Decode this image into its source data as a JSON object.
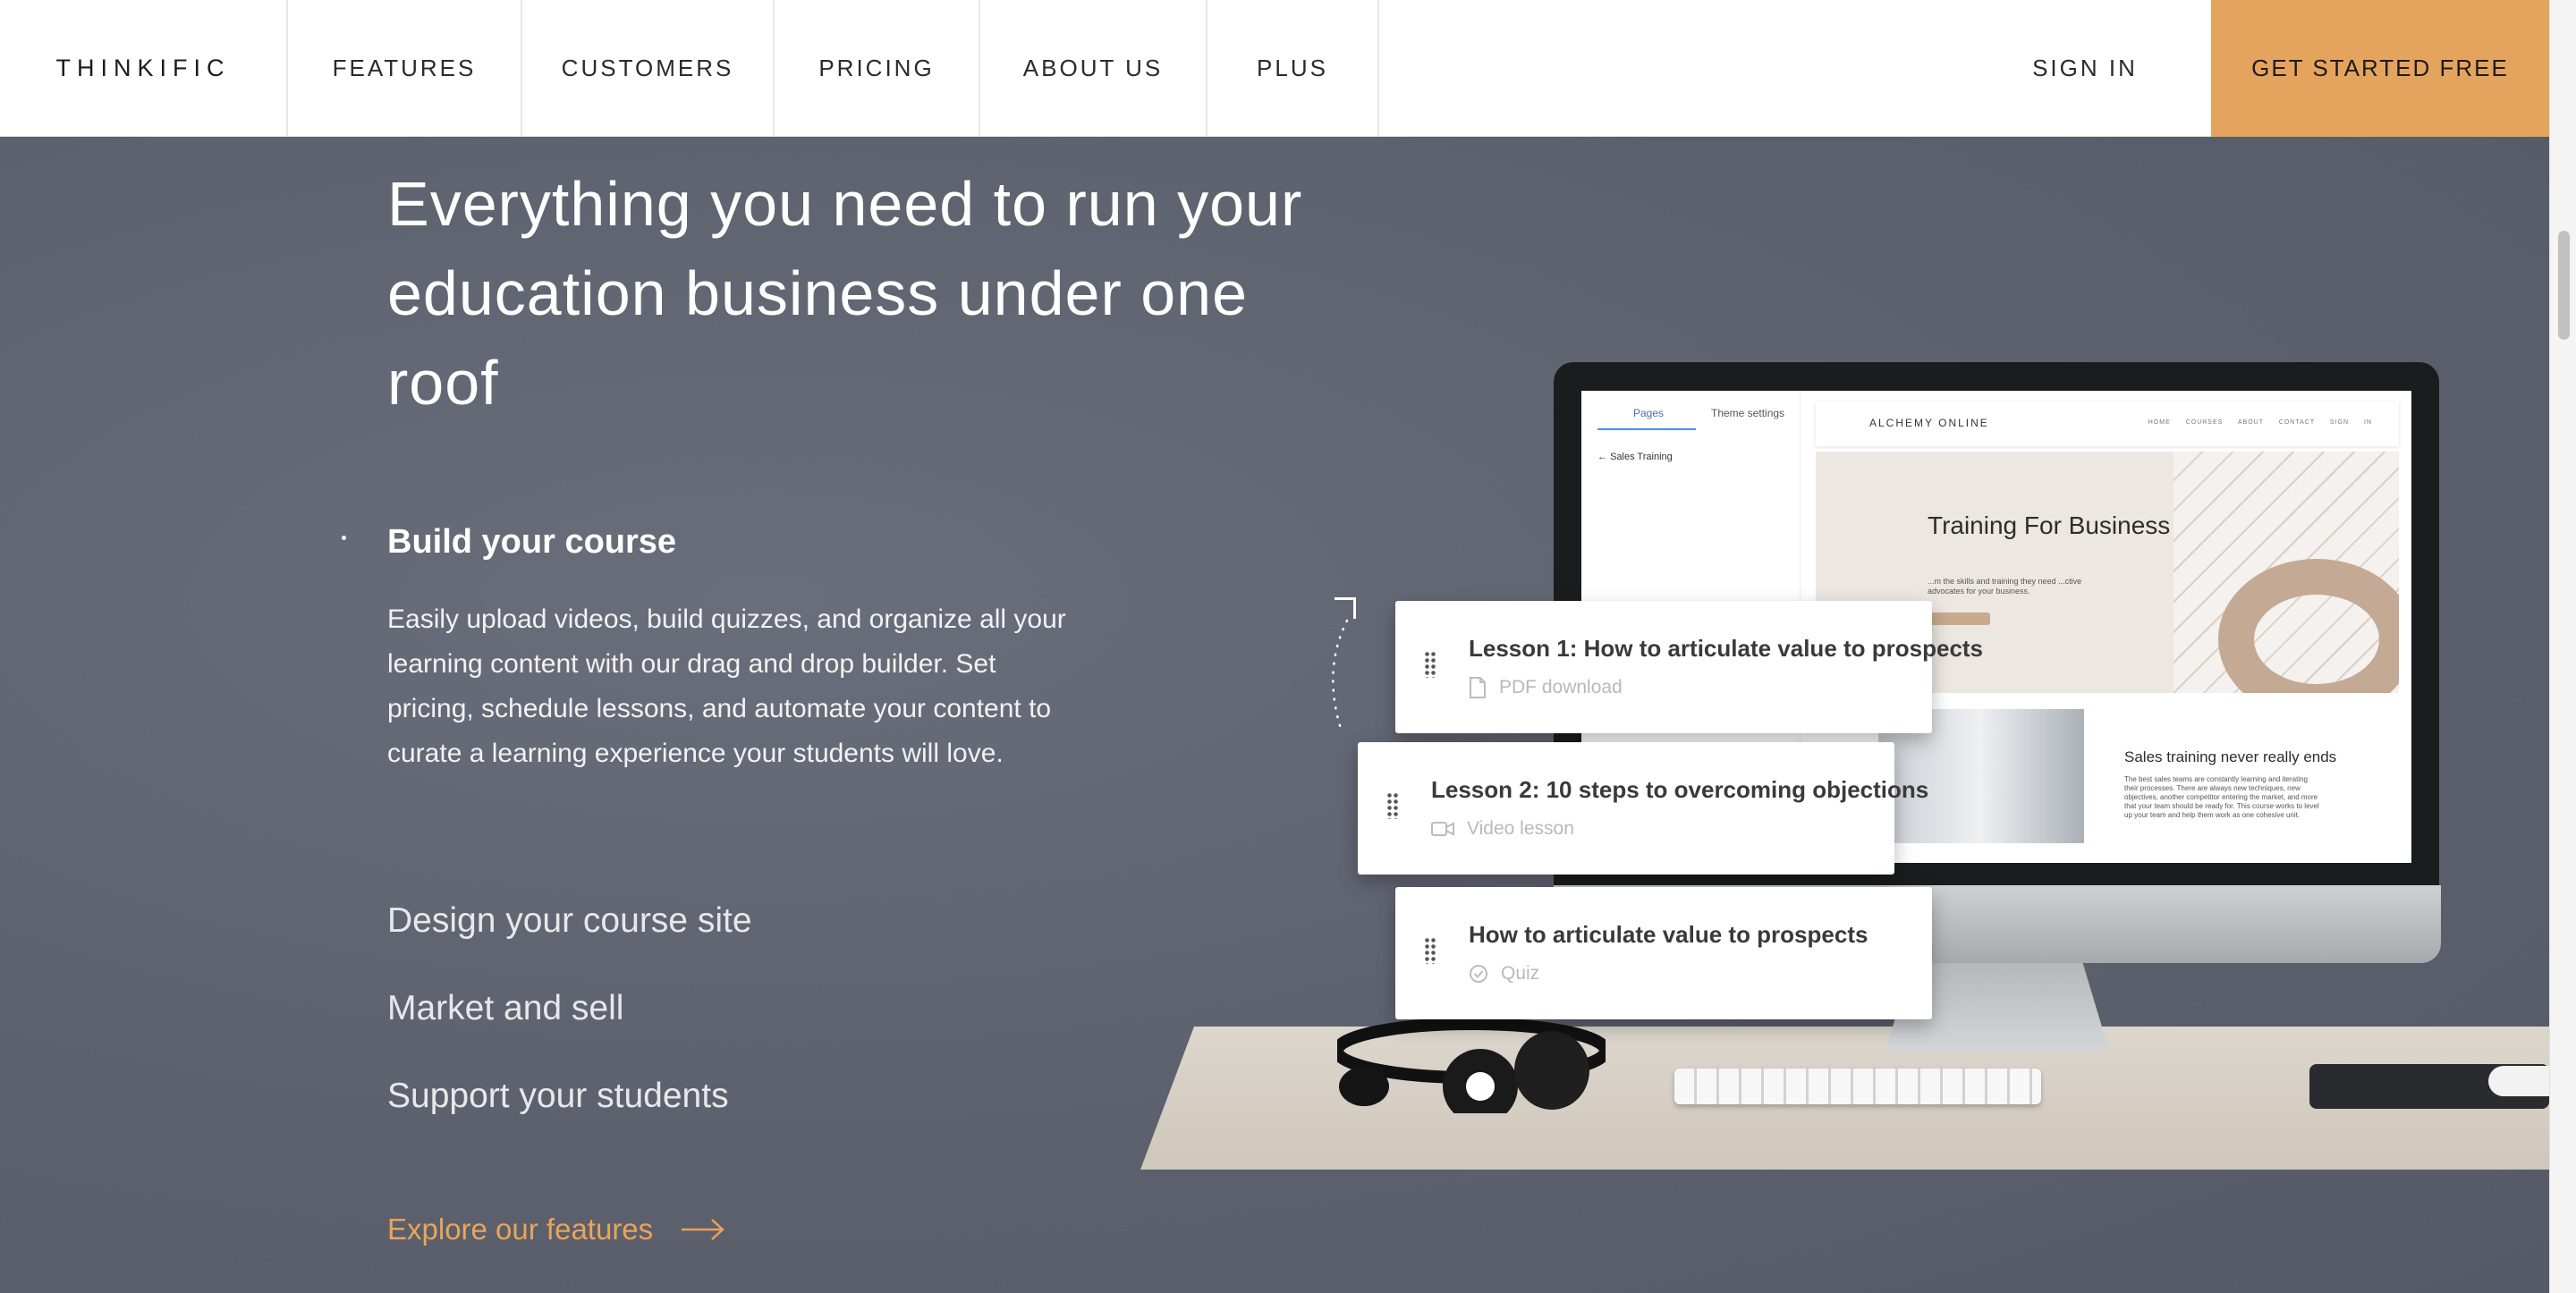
{
  "nav": {
    "logo": "THINKIFIC",
    "items": [
      "FEATURES",
      "CUSTOMERS",
      "PRICING",
      "ABOUT US",
      "PLUS"
    ],
    "sign_in": "SIGN IN",
    "cta": "GET STARTED FREE"
  },
  "hero": {
    "headline": "Everything you need to run your education business under one roof",
    "active_feature": {
      "title": "Build your course",
      "description": "Easily upload videos, build quizzes, and organize all your learning content with our drag and drop builder. Set pricing, schedule lessons, and automate your content to curate a learning experience your students will love."
    },
    "other_features": [
      "Design your course site",
      "Market and sell",
      "Support your students"
    ],
    "explore_link": "Explore our features"
  },
  "illustration": {
    "screen": {
      "tab_pages": "Pages",
      "tab_theme": "Theme settings",
      "sidebar_item": "Sales Training",
      "brand": "ALCHEMY ONLINE",
      "menu": "HOME COURSES ABOUT CONTACT SIGN IN",
      "hero_title": "Training For Business",
      "hero_sub": "...m the skills and training they need ...ctive advocates for your business.",
      "lower_title": "Sales training never really ends",
      "lower_text": "The best sales teams are constantly learning and iterating their processes. There are always new techniques, new objectives, another competitor entering the market, and more that your team should be ready for. This course works to level up your team and help them work as one cohesive unit."
    },
    "lessons": [
      {
        "title": "Lesson 1: How to articulate value to prospects",
        "type": "PDF download",
        "icon": "document-icon"
      },
      {
        "title": "Lesson 2: 10 steps to overcoming objections",
        "type": "Video lesson",
        "icon": "video-icon"
      },
      {
        "title": "How to articulate value to prospects",
        "type": "Quiz",
        "icon": "check-circle-icon"
      }
    ]
  },
  "colors": {
    "accent": "#e5a45e",
    "hero_bg": "#5f6370",
    "link": "#e9a45a"
  }
}
